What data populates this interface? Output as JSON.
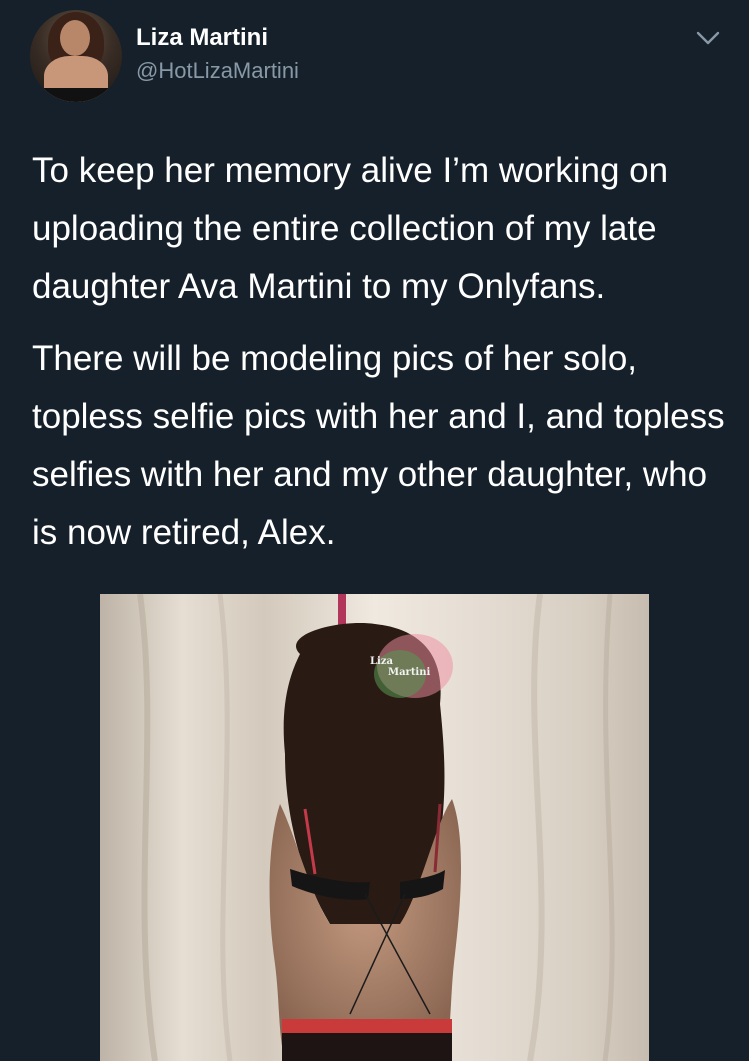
{
  "tweet": {
    "author_name": "Liza Martini",
    "author_handle": "@HotLizaMartini",
    "paragraphs": [
      "To keep her memory alive I’m working on uploading the entire collection of my late daughter Ava Martini to my Onlyfans.",
      "There will be modeling pics of her solo, topless selfie pics with her and I, and topless selfies with her and my other daughter, who is now retired, Alex."
    ],
    "watermark": {
      "line1": "Liza",
      "line2": "Martini"
    }
  },
  "icons": {
    "more": "chevron-down-icon"
  },
  "colors": {
    "background": "#15202b",
    "text": "#ffffff",
    "secondary_text": "#8899a6"
  }
}
